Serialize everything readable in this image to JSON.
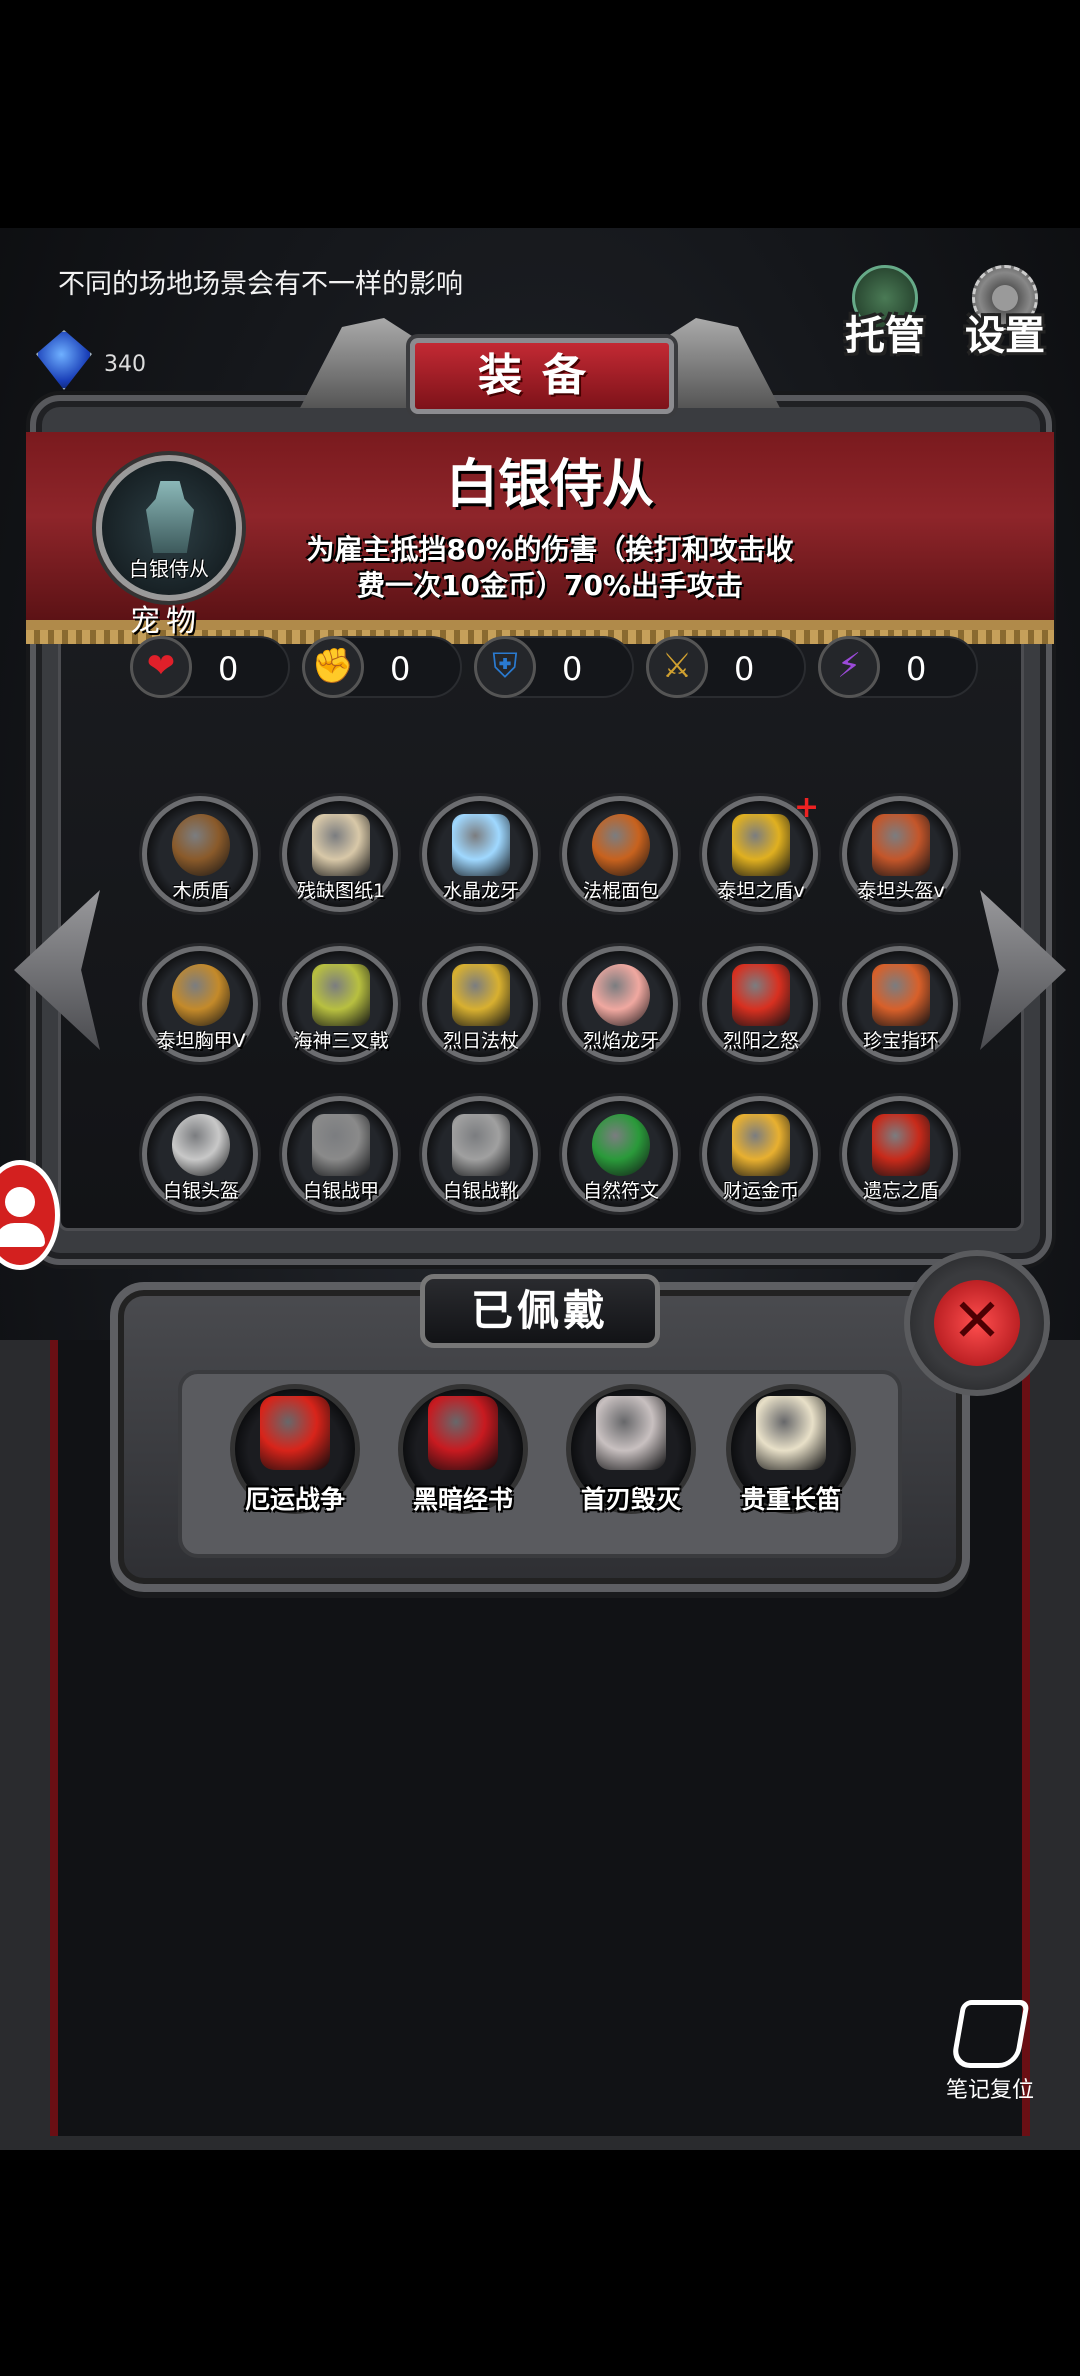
{
  "hint": "不同的场地场景会有不一样的影响",
  "currency": {
    "gem_count": "340"
  },
  "top_buttons": {
    "auto": "托管",
    "settings": "设置"
  },
  "panel": {
    "title": "装备",
    "pet_name": "白银侍从",
    "pet_label": "宠物",
    "item_name": "白银侍从",
    "item_desc_line1": "为雇主抵挡80%的伤害（挨打和攻击收",
    "item_desc_line2": "费一次10金币）70%出手攻击"
  },
  "stats": [
    {
      "icon": "heart-icon",
      "glyph": "❤",
      "color": "#e0202a",
      "value": "0"
    },
    {
      "icon": "strength-icon",
      "glyph": "✊",
      "color": "#e0c020",
      "value": "0"
    },
    {
      "icon": "armor-icon",
      "glyph": "⛨",
      "color": "#2a7ad0",
      "value": "0"
    },
    {
      "icon": "sword-icon",
      "glyph": "⚔",
      "color": "#d0a030",
      "value": "0"
    },
    {
      "icon": "lightning-icon",
      "glyph": "⚡",
      "color": "#9b4ad8",
      "value": "0"
    }
  ],
  "equipment": [
    {
      "name": "木质盾",
      "color": "#8a5a2a"
    },
    {
      "name": "残缺图纸1",
      "color": "#d8c8a8"
    },
    {
      "name": "水晶龙牙",
      "color": "#9fd8ff"
    },
    {
      "name": "法棍面包",
      "color": "#c8621e"
    },
    {
      "name": "泰坦之盾v",
      "color": "#e0b020"
    },
    {
      "name": "泰坦头盔v",
      "color": "#c4562a"
    },
    {
      "name": "泰坦胸甲V",
      "color": "#c48a2a"
    },
    {
      "name": "海神三叉戟",
      "color": "#b8c040"
    },
    {
      "name": "烈日法杖",
      "color": "#d8b030"
    },
    {
      "name": "烈焰龙牙",
      "color": "#f0a8a0"
    },
    {
      "name": "烈阳之怒",
      "color": "#d83020"
    },
    {
      "name": "珍宝指环",
      "color": "#d8602a"
    },
    {
      "name": "白银头盔",
      "color": "#c8c8c8"
    },
    {
      "name": "白银战甲",
      "color": "#8a8a8a"
    },
    {
      "name": "白银战靴",
      "color": "#a0a0a0"
    },
    {
      "name": "自然符文",
      "color": "#2a9a3a"
    },
    {
      "name": "财运金币",
      "color": "#e8b030"
    },
    {
      "name": "遗忘之盾",
      "color": "#c82a1a"
    }
  ],
  "worn": {
    "title": "已佩戴",
    "items": [
      {
        "name": "厄运战争",
        "color": "#d8241a"
      },
      {
        "name": "黑暗经书",
        "color": "#c81a20"
      },
      {
        "name": "首刃毁灭",
        "color": "#c8c0c0"
      },
      {
        "name": "贵重长笛",
        "color": "#e8e0c8"
      }
    ]
  },
  "reset_label": "笔记复位"
}
